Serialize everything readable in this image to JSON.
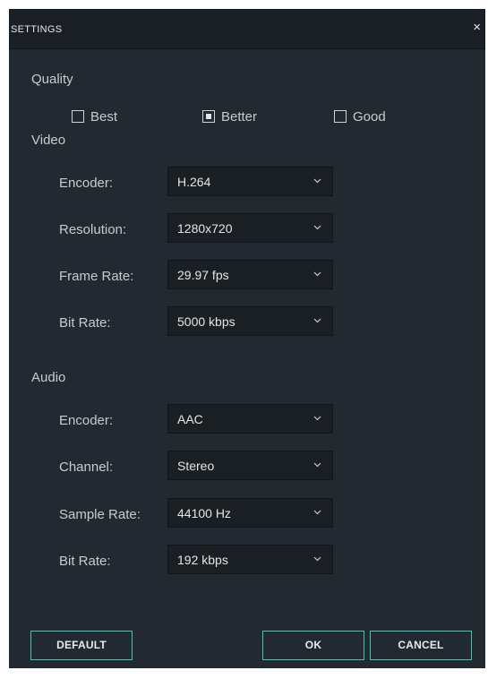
{
  "dialog": {
    "title": "SETTINGS",
    "close_glyph": "×"
  },
  "quality": {
    "label": "Quality",
    "options": [
      {
        "label": "Best",
        "checked": false
      },
      {
        "label": "Better",
        "checked": true
      },
      {
        "label": "Good",
        "checked": false
      }
    ]
  },
  "video": {
    "label": "Video",
    "fields": [
      {
        "label": "Encoder:",
        "value": "H.264"
      },
      {
        "label": "Resolution:",
        "value": "1280x720"
      },
      {
        "label": "Frame Rate:",
        "value": "29.97 fps"
      },
      {
        "label": "Bit Rate:",
        "value": "5000 kbps"
      }
    ]
  },
  "audio": {
    "label": "Audio",
    "fields": [
      {
        "label": "Encoder:",
        "value": "AAC"
      },
      {
        "label": "Channel:",
        "value": "Stereo"
      },
      {
        "label": "Sample Rate:",
        "value": "44100 Hz"
      },
      {
        "label": "Bit Rate:",
        "value": "192 kbps"
      }
    ]
  },
  "buttons": {
    "default_label": "DEFAULT",
    "ok_label": "OK",
    "cancel_label": "CANCEL"
  },
  "colors": {
    "background": "#222931",
    "titlebar": "#1a1f25",
    "select_background": "#1a1f24",
    "accent": "#42c6b6",
    "text": "#c8ccd2"
  },
  "icons": {
    "close": "close-icon",
    "dropdown": "chevron-down-icon",
    "checkbox": "checkbox-icon"
  }
}
